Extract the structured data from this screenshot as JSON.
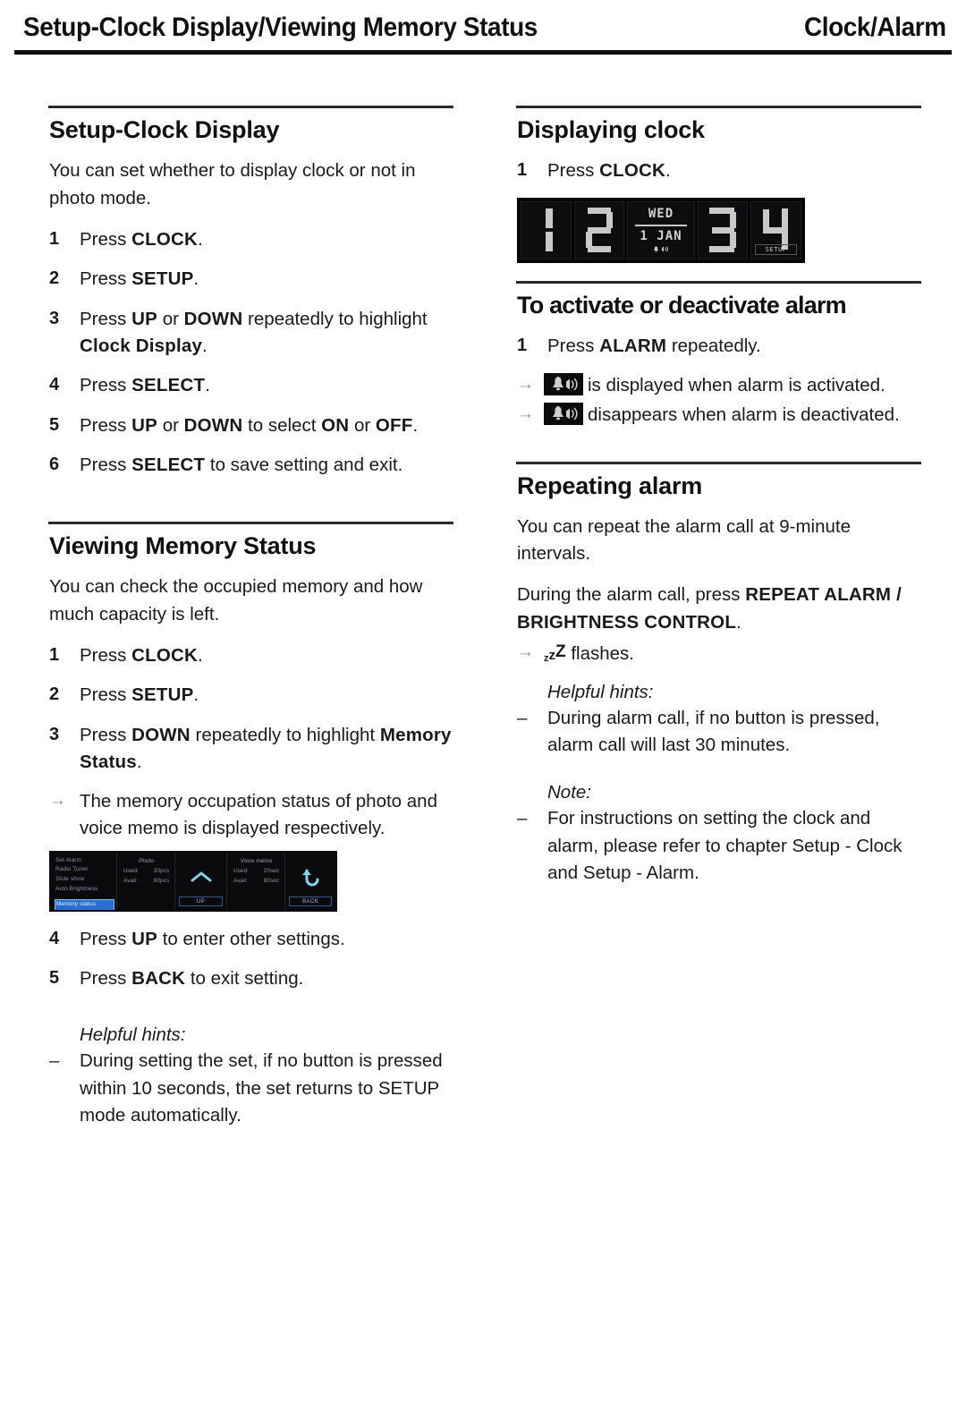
{
  "header": {
    "left": "Setup-Clock Display/Viewing Memory Status",
    "right": "Clock/Alarm"
  },
  "left_column": {
    "setup_clock_display": {
      "title": "Setup-Clock Display",
      "intro": "You can set whether to display clock or not in photo mode.",
      "steps": [
        {
          "num": "1",
          "html": "Press <b>CLOCK</b>."
        },
        {
          "num": "2",
          "html": "Press <b>SETUP</b>."
        },
        {
          "num": "3",
          "html": "Press <b>UP</b> or <b>DOWN</b> repeatedly to highlight <b>Clock Display</b>."
        },
        {
          "num": "4",
          "html": "Press <b>SELECT</b>."
        },
        {
          "num": "5",
          "html": "Press <b>UP</b> or <b>DOWN</b> to select <b>ON</b> or <b>OFF</b>."
        },
        {
          "num": "6",
          "html": "Press <b>SELECT</b> to save setting and exit."
        }
      ]
    },
    "viewing_memory_status": {
      "title": "Viewing Memory Status",
      "intro": "You can check the occupied memory and how much capacity is left.",
      "steps": [
        {
          "num": "1",
          "html": "Press <b>CLOCK</b>."
        },
        {
          "num": "2",
          "html": "Press <b>SETUP</b>."
        },
        {
          "num": "3",
          "html": "Press <b>DOWN</b> repeatedly to highlight <b>Memory Status</b>."
        }
      ],
      "result_arrow": "→",
      "result": "The memory occupation status of photo and voice memo is displayed respectively.",
      "steps_after": [
        {
          "num": "4",
          "html": "Press <b>UP</b> to enter other settings."
        },
        {
          "num": "5",
          "html": "Press <b>BACK</b> to exit setting."
        }
      ],
      "hints_label": "Helpful hints:",
      "hints": [
        {
          "dash": "–",
          "text": "During setting the set, if no button is pressed within 10 seconds, the set returns to SETUP mode automatically."
        }
      ]
    },
    "memory_lcd": {
      "menu_items": [
        "Set Alarm",
        "Radio Tuner",
        "Slide show",
        "Auto Brightness"
      ],
      "menu_selected": "Memory status",
      "photo_title": "Photo",
      "photo_rows": [
        {
          "key": "Used:",
          "value": "20pcs"
        },
        {
          "key": "Avail:",
          "value": "80pcs"
        }
      ],
      "voice_title": "Voice memo",
      "voice_rows": [
        {
          "key": "Used:",
          "value": "20sec"
        },
        {
          "key": "Avail:",
          "value": "80sec"
        }
      ],
      "up_button": "UP",
      "back_button": "BACK"
    }
  },
  "right_column": {
    "displaying_clock": {
      "title": "Displaying clock",
      "steps": [
        {
          "num": "1",
          "html": "Press <b>CLOCK</b>."
        }
      ]
    },
    "clock_lcd": {
      "digit_1": "1",
      "digit_2": "2",
      "weekday": "WED",
      "date": "1 JAN",
      "digit_3": "3",
      "digit_4": "4",
      "setup_tag": "SETUP",
      "status_icons": "bell-icon, speaker-icon"
    },
    "activate_alarm": {
      "title": "To activate or deactivate alarm",
      "steps": [
        {
          "num": "1",
          "html": "Press <b>ALARM</b> repeatedly."
        }
      ],
      "results": [
        {
          "arrow": "→",
          "icon": "alarm-bell-icon",
          "text": "is displayed when alarm is activated."
        },
        {
          "arrow": "→",
          "icon": "alarm-bell-icon",
          "text": "disappears when alarm is deactivated."
        }
      ]
    },
    "repeating_alarm": {
      "title": "Repeating alarm",
      "intro": "You can repeat the alarm call at 9-minute intervals.",
      "instruction_html": "During the alarm call, press <b>REPEAT ALARM / BRIGHTNESS CONTROL</b>.",
      "result_arrow": "→",
      "result_suffix": "flashes.",
      "result_glyph": "zzZ",
      "hints_label": "Helpful hints:",
      "hints": [
        {
          "dash": "–",
          "text": "During alarm call, if no button is pressed, alarm call will last 30 minutes."
        }
      ],
      "note_label": "Note:",
      "notes": [
        {
          "dash": "–",
          "text": "For instructions on setting the clock and alarm, please refer to chapter Setup - Clock and Setup - Alarm."
        }
      ]
    }
  }
}
